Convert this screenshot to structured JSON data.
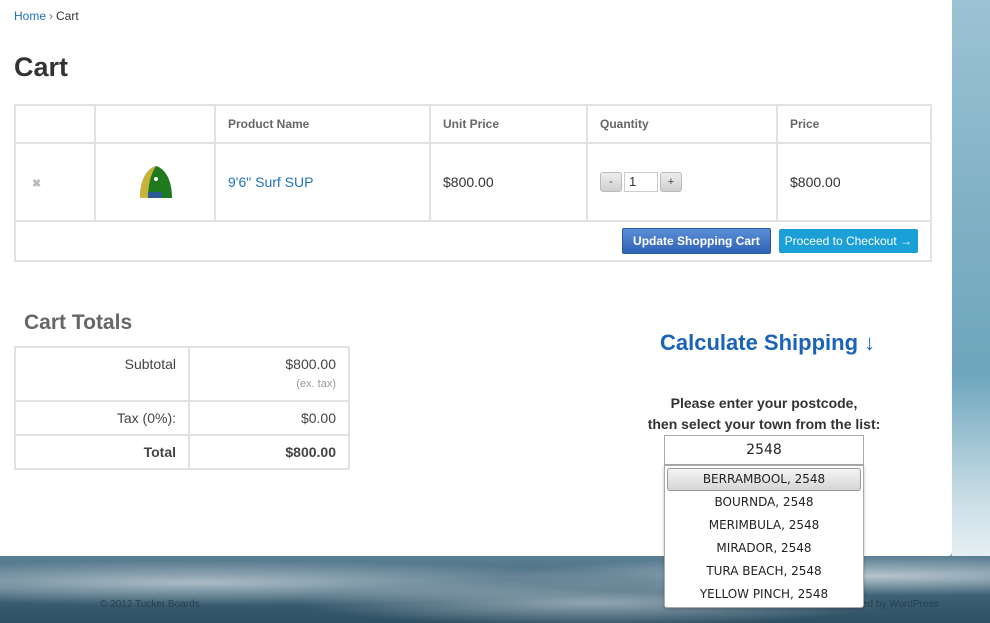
{
  "breadcrumb": {
    "home": "Home",
    "separator": "›",
    "current": "Cart"
  },
  "page_title": "Cart",
  "cart_table": {
    "headers": [
      "",
      "",
      "Product Name",
      "Unit Price",
      "Quantity",
      "Price"
    ],
    "rows": [
      {
        "remove": "✖",
        "product": "9'6\" Surf SUP",
        "unit_price": "$800.00",
        "quantity": "1",
        "price": "$800.00"
      }
    ],
    "qty_minus": "-",
    "qty_plus": "+",
    "update_label": "Update Shopping Cart",
    "checkout_label": "Proceed to Checkout →"
  },
  "totals": {
    "title": "Cart Totals",
    "rows": [
      {
        "label": "Subtotal",
        "value": "$800.00",
        "note": "(ex. tax)"
      },
      {
        "label": "Tax (0%):",
        "value": "$0.00"
      },
      {
        "label": "Total",
        "value": "$800.00"
      }
    ]
  },
  "shipping": {
    "title": "Calculate Shipping ↓",
    "instruction_line1": "Please enter your postcode,",
    "instruction_line2": "then select your town from the list:",
    "postcode_value": "2548",
    "towns": [
      "BERRAMBOOL, 2548",
      "BOURNDA, 2548",
      "MERIMBULA, 2548",
      "MIRADOR, 2548",
      "TURA BEACH, 2548",
      "YELLOW PINCH, 2548"
    ],
    "selected_town": "BERRAMBOOL, 2548"
  },
  "footer": {
    "left": "© 2012 Tucker Boards",
    "right": "ed by WordPress"
  },
  "colors": {
    "link": "#1e73be",
    "update_button": "#2f62b3",
    "checkout_button": "#1a9fd6",
    "heading_blue": "#1a63b8"
  }
}
